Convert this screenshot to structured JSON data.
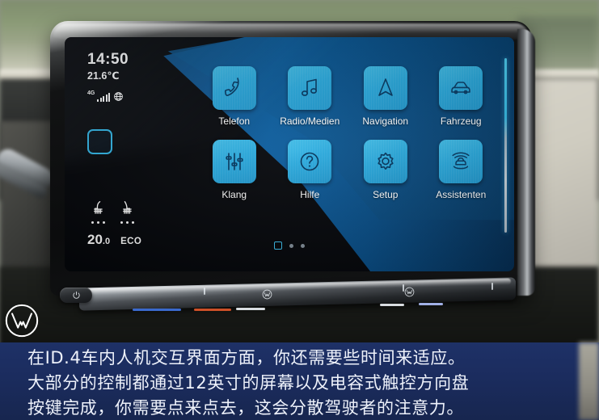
{
  "screen": {
    "status": {
      "time": "14:50",
      "temperature": "21.6℃",
      "network_label": "4G",
      "network_icon": "signal-bars-globe-icon",
      "home_button_icon": "home-square-icon"
    },
    "climate": {
      "driver_seat_icon": "heated-seat-icon",
      "passenger_seat_icon": "heated-seat-icon",
      "driver_temp": "20.0",
      "driver_temp_main": "20",
      "driver_temp_frac": ".0",
      "mode": "ECO"
    },
    "apps": [
      {
        "label": "Telefon",
        "icon": "phone-icon"
      },
      {
        "label": "Radio/Medien",
        "icon": "music-note-icon"
      },
      {
        "label": "Navigation",
        "icon": "navigation-arrow-icon"
      },
      {
        "label": "Fahrzeug",
        "icon": "car-icon"
      },
      {
        "label": "Klang",
        "icon": "equalizer-sliders-icon"
      },
      {
        "label": "Hilfe",
        "icon": "question-mark-circle-icon"
      },
      {
        "label": "Setup",
        "icon": "gear-icon"
      },
      {
        "label": "Assistenten",
        "icon": "driver-assistance-radar-icon"
      }
    ],
    "pager": {
      "active_index": 0,
      "count": 3
    },
    "scrollbar_icon": "vertical-slider"
  },
  "hardware": {
    "power_button_icon": "power-icon",
    "slider_bar_name": "capacitive-touch-slider"
  },
  "caption": {
    "lines": [
      "在ID.4车内人机交互界面方面，你还需要些时间来适应。",
      "大部分的控制都通过12英寸的屏幕以及电容式触控方向盘",
      "按键完成，你需要点来点去，这会分散驾驶者的注意力。"
    ]
  },
  "branding": {
    "logo_icon": "volkswagen-logo-icon"
  },
  "colors": {
    "tile_blue": "#28a9dd",
    "accent_cyan": "#3cc0ef",
    "caption_navy": "#1b2c5e",
    "panel_blue": "#0b5d9e"
  }
}
